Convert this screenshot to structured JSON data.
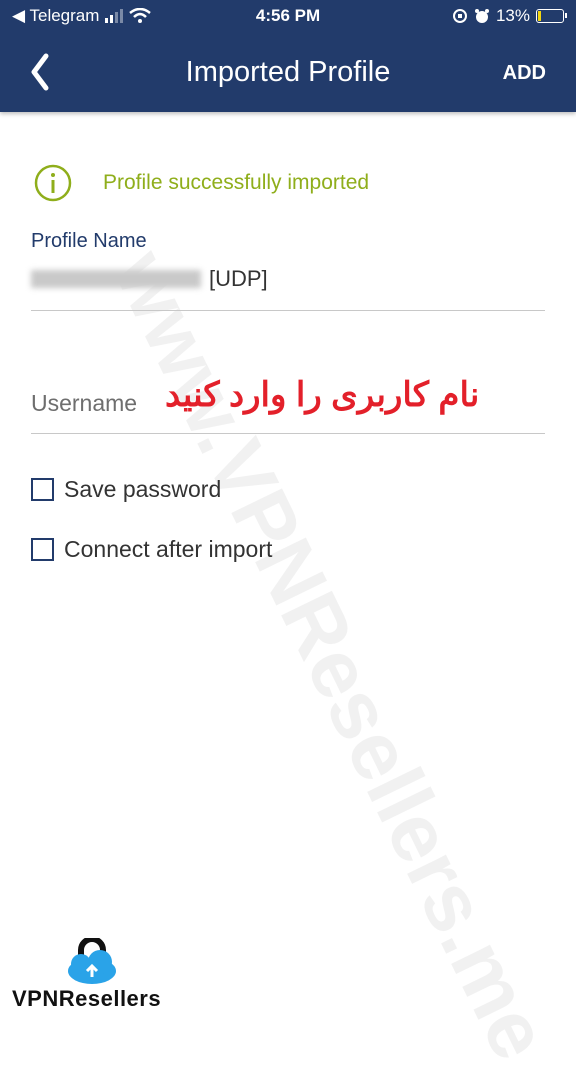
{
  "status_bar": {
    "carrier": "◀ Telegram",
    "time": "4:56 PM",
    "battery_percent": "13%",
    "battery_level": 0.13
  },
  "nav": {
    "title": "Imported Profile",
    "add_label": "ADD"
  },
  "info": {
    "message": "Profile successfully imported"
  },
  "profile": {
    "label": "Profile Name",
    "value_suffix": "[UDP]"
  },
  "username": {
    "placeholder": "Username",
    "annotation": "نام کاربری را وارد کنید"
  },
  "options": {
    "save_password": "Save password",
    "connect_after_import": "Connect after import"
  },
  "watermark": "www.VPNResellers.me",
  "logo": {
    "text": "VPNResellers"
  },
  "colors": {
    "header_bg": "#223b6b",
    "success": "#8fae1b",
    "annotation": "#e3202a"
  }
}
